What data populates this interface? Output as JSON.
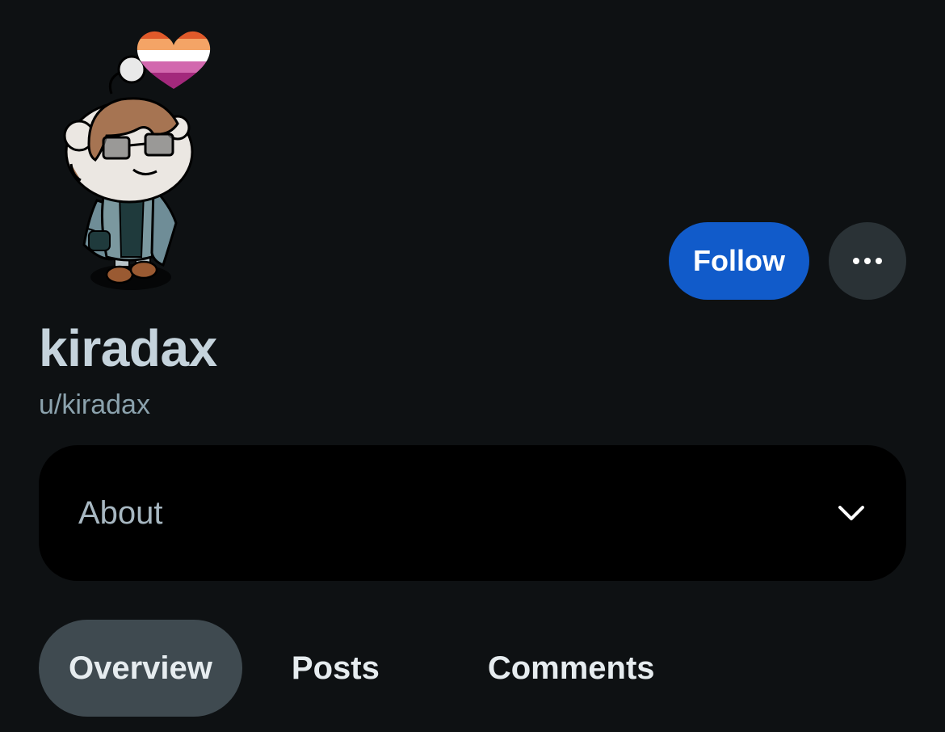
{
  "profile": {
    "display_name": "kiradax",
    "username": "u/kiradax",
    "avatar_icon": "snoo-avatar-icon"
  },
  "actions": {
    "follow_label": "Follow",
    "more_icon": "more-horizontal-icon"
  },
  "about": {
    "label": "About",
    "icon": "chevron-down-icon"
  },
  "tabs": [
    {
      "label": "Overview",
      "active": true
    },
    {
      "label": "Posts",
      "active": false
    },
    {
      "label": "Comments",
      "active": false
    }
  ],
  "colors": {
    "background": "#0e1113",
    "accent": "#115bca",
    "tab_active": "#3f4a50"
  }
}
